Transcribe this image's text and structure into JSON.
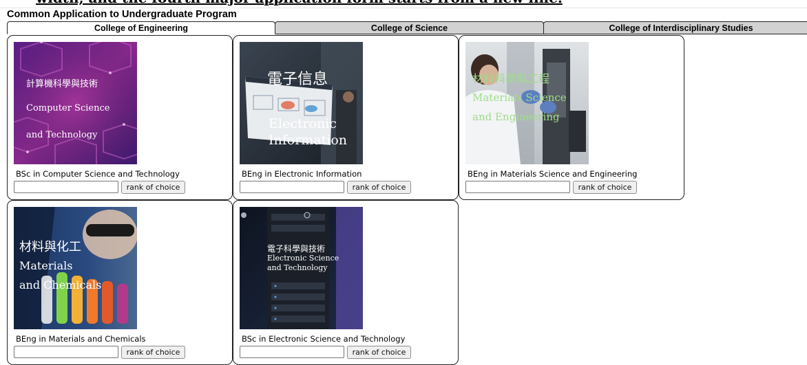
{
  "cut_heading": "width, and the fourth major application form starts from a new line.",
  "form_title": "Common Application to Undergraduate Program",
  "tabs": [
    {
      "label": "College of Engineering",
      "active": true
    },
    {
      "label": "College of Science",
      "active": false
    },
    {
      "label": "College of Interdisciplinary Studies",
      "active": false
    }
  ],
  "programs": [
    {
      "name": "BSc in Computer Science and Technology",
      "image_lines": [
        "計算機科學與技術",
        "Computer Science",
        "and Technology"
      ],
      "input_value": "",
      "button_label": "rank of choice"
    },
    {
      "name": "BEng in Electronic Information",
      "image_lines": [
        "電子信息",
        "Electronic",
        "Information"
      ],
      "input_value": "",
      "button_label": "rank of choice"
    },
    {
      "name": "BEng in Materials Science and Engineering",
      "image_lines": [
        "材料科學與工程",
        "Materials Science",
        "and Engineering"
      ],
      "input_value": "",
      "button_label": "rank of choice"
    },
    {
      "name": "BEng in Materials and Chemicals",
      "image_lines": [
        "材料與化工",
        "Materials",
        "and Chemicals"
      ],
      "input_value": "",
      "button_label": "rank of choice"
    },
    {
      "name": "BSc in Electronic Science and Technology",
      "image_lines": [
        "電子科學與技術",
        "Electronic Science",
        "and Technology"
      ],
      "input_value": "",
      "button_label": "rank of choice"
    }
  ]
}
